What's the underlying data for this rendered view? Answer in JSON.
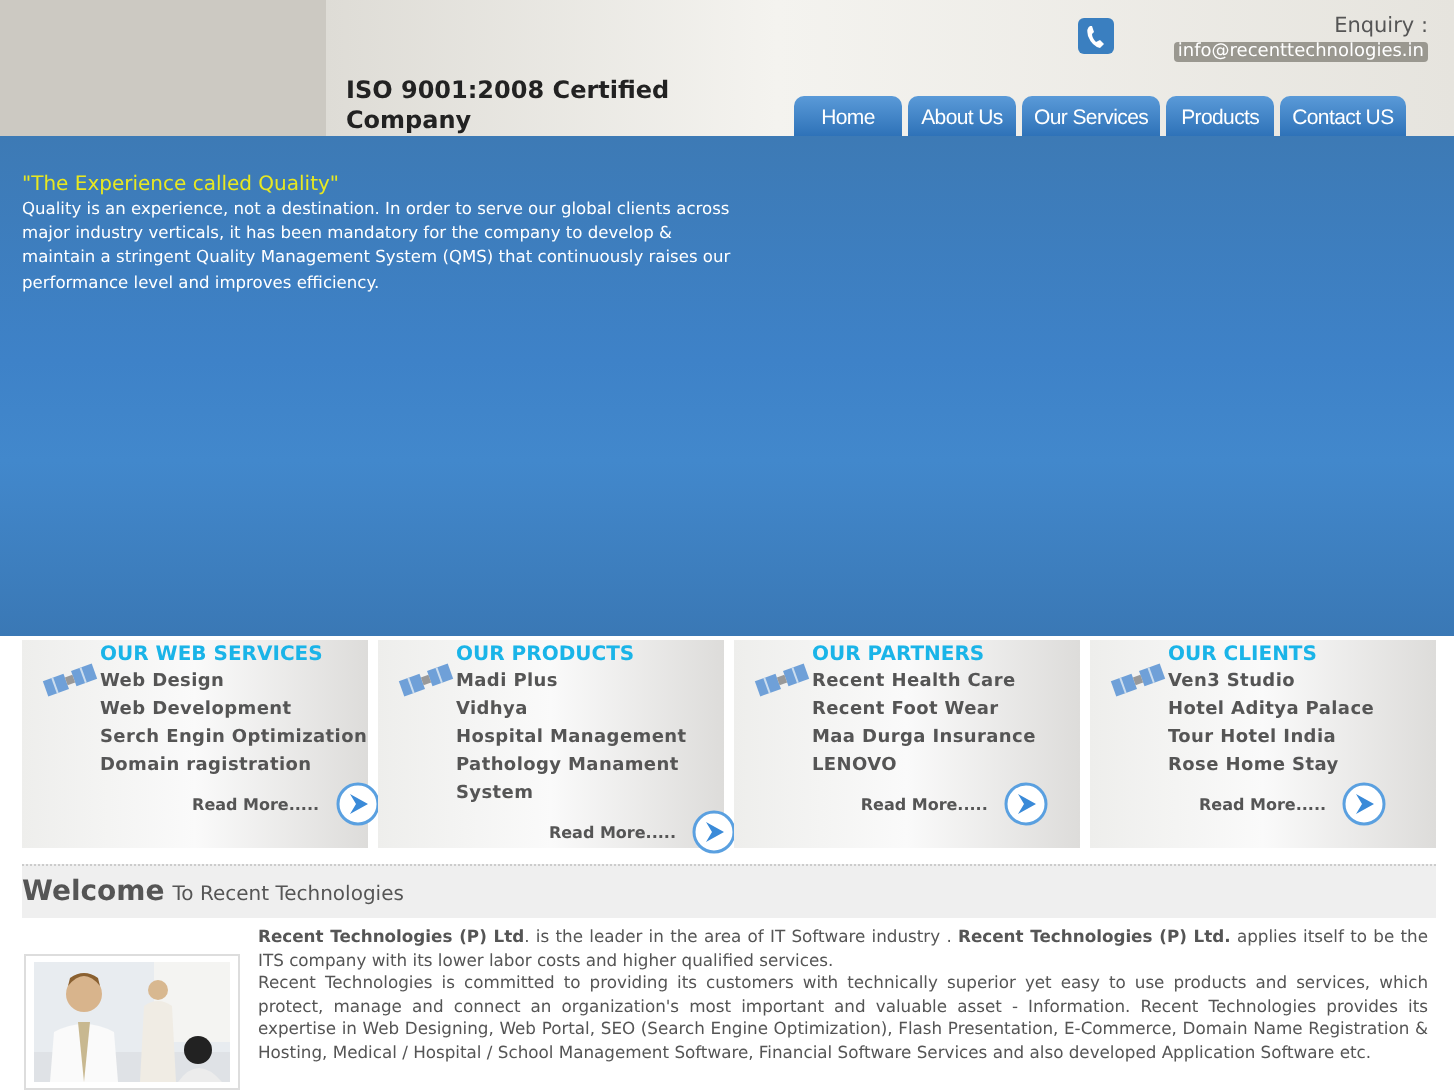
{
  "header": {
    "certification": "ISO 9001:2008 Certified Company",
    "enquiry_label": "Enquiry :",
    "enquiry_email": "info@recenttechnologies.in"
  },
  "nav": [
    {
      "label": "Home"
    },
    {
      "label": "About Us"
    },
    {
      "label": "Our Services"
    },
    {
      "label": "Products"
    },
    {
      "label": "Contact US"
    }
  ],
  "banner": {
    "quote": "\"The Experience called Quality\"",
    "text": "Quality is an experience, not a destination. In order to serve our global clients across major industry verticals, it has been mandatory for the company to develop & maintain a stringent Quality Management System (QMS) that continuously raises our performance level and improves efficiency."
  },
  "cards": [
    {
      "title": "OUR WEB SERVICES",
      "items": [
        "Web Design",
        "Web Development",
        "Serch Engin Optimization",
        "Domain ragistration"
      ],
      "link": "Read More....."
    },
    {
      "title": "OUR PRODUCTS",
      "items": [
        "Madi Plus",
        "Vidhya",
        "Hospital Management",
        "Pathology Manament System"
      ],
      "link": "Read More....."
    },
    {
      "title": "OUR PARTNERS",
      "items": [
        "Recent Health Care",
        "Recent Foot Wear",
        "Maa Durga Insurance",
        "LENOVO"
      ],
      "link": "Read More....."
    },
    {
      "title": "OUR CLIENTS",
      "items": [
        "Ven3 Studio",
        "Hotel Aditya Palace",
        "Tour Hotel India",
        "Rose Home Stay"
      ],
      "link": "Read More....."
    }
  ],
  "welcome": {
    "title": "Welcome",
    "subtitle": "To Recent Technologies",
    "paragraphs": [
      "**Recent Technologies (P) Ltd**. is the leader in the area of IT Software industry . **Recent Technologies (P) Ltd.** applies itself to be the ITS company with its lower labor costs and higher qualified services.",
      "Recent Technologies is committed to providing its customers with technically superior yet easy to use products and services, which protect, manage and connect an organization's most important and valuable asset - Information. Recent Technologies provides its expertise in Web Designing, Web Portal, SEO (Search Engine Optimization), Flash Presentation, E-Commerce, Domain Name Registration & Hosting, Medical / Hospital / School Management Software, Financial Software Services and also developed Application Software etc."
    ]
  }
}
